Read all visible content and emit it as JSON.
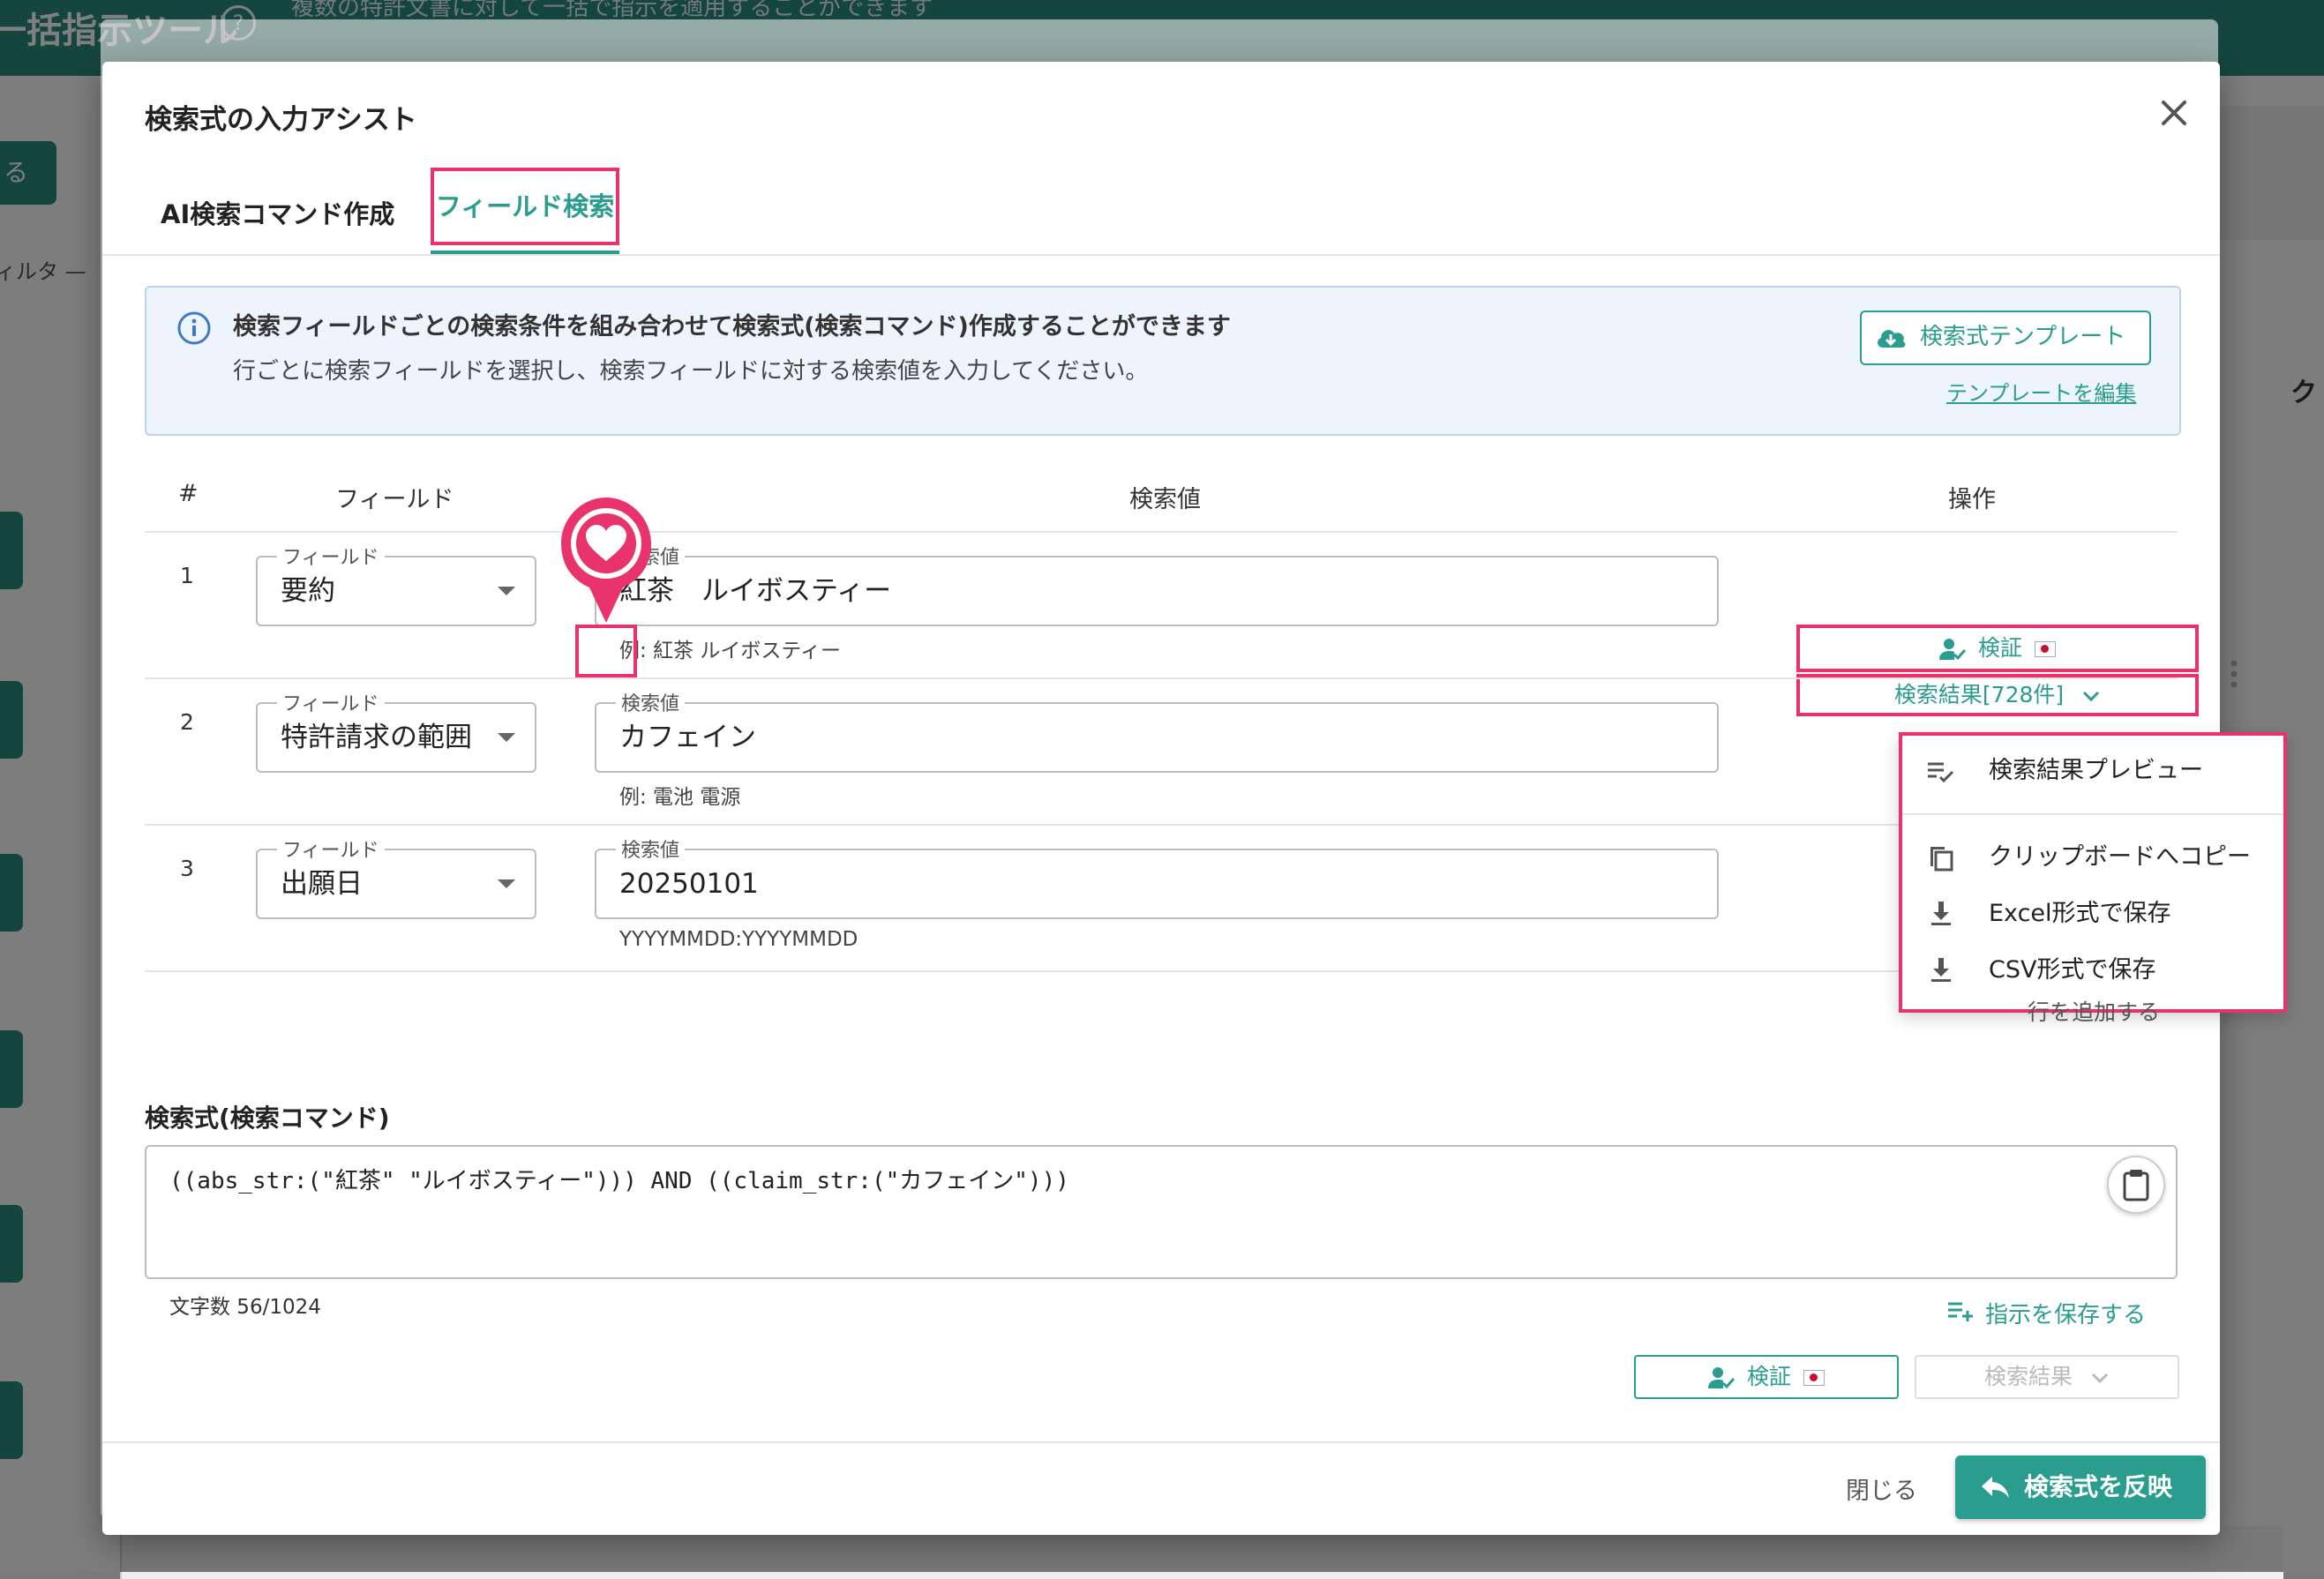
{
  "background": {
    "app_title": "一括指示ツール",
    "subtitle": "複数の特許文書に対して一括で指示を適用することができます",
    "left_button_label": "る",
    "filter_label": "ィルタ —",
    "right_column_label": "ク"
  },
  "modal": {
    "title": "検索式の入力アシスト",
    "close_icon": "close-icon"
  },
  "tabs": [
    {
      "label": "AI検索コマンド作成",
      "active": false
    },
    {
      "label": "フィールド検索",
      "active": true
    }
  ],
  "info": {
    "title": "検索フィールドごとの検索条件を組み合わせて検索式(検索コマンド)作成することができます",
    "description": "行ごとに検索フィールドを選択し、検索フィールドに対する検索値を入力してください。",
    "template_button": "検索式テンプレート",
    "template_edit_link": "テンプレートを編集"
  },
  "table": {
    "headers": {
      "num": "#",
      "field": "フィールド",
      "value": "検索値",
      "ops": "操作"
    },
    "field_legend": "フィールド",
    "value_legend": "検索値",
    "rows": [
      {
        "num": "1",
        "field": "要約",
        "value": "紅茶　ルイボスティー",
        "hint": "例: 紅茶 ルイボスティー"
      },
      {
        "num": "2",
        "field": "特許請求の範囲",
        "value": "カフェイン",
        "hint": "例: 電池 電源"
      },
      {
        "num": "3",
        "field": "出願日",
        "value": "20250101",
        "hint": "YYYYMMDD:YYYYMMDD"
      }
    ],
    "verify_label": "検証",
    "results_label": "検索結果[728件]",
    "add_row": "行を追加する"
  },
  "results_menu": {
    "items": [
      {
        "icon": "playlist-check-icon",
        "label": "検索結果プレビュー"
      },
      {
        "icon": "copy-icon",
        "label": "クリップボードへコピー"
      },
      {
        "icon": "download-icon",
        "label": "Excel形式で保存"
      },
      {
        "icon": "download-icon",
        "label": "CSV形式で保存"
      }
    ]
  },
  "command": {
    "title": "検索式(検索コマンド)",
    "text": "((abs_str:(\"紅茶\" \"ルイボスティー\"))) AND ((claim_str:(\"カフェイン\")))",
    "char_count": "文字数 56/1024",
    "save_instruction": "指示を保存する",
    "verify_label": "検証",
    "results_label": "検索結果"
  },
  "footer": {
    "close": "閉じる",
    "apply": "検索式を反映"
  },
  "colors": {
    "primary": "#2a9d8f",
    "highlight": "#e8336d",
    "info_bg": "#eef4fc"
  }
}
